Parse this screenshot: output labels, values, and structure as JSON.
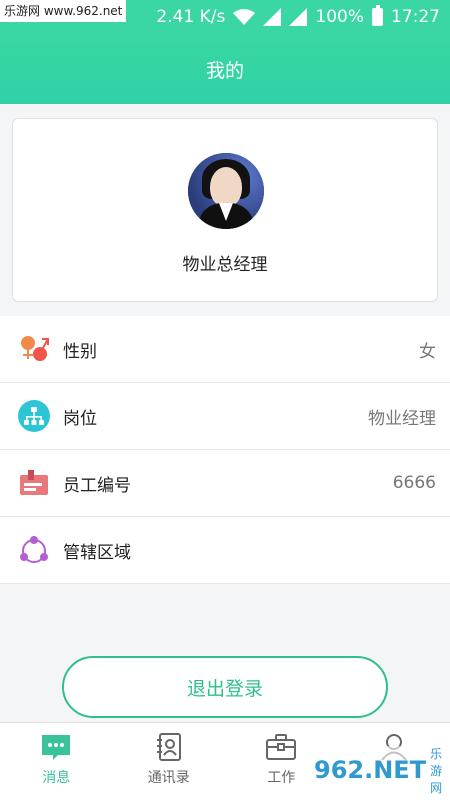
{
  "status": {
    "watermark": "乐游网 www.962.net",
    "speed": "2.41 K/s",
    "battery": "100%",
    "time": "17:27"
  },
  "header": {
    "title": "我的"
  },
  "profile": {
    "name": "物业总经理"
  },
  "info_list": [
    {
      "label": "性别",
      "value": "女",
      "icon": "gender-icon"
    },
    {
      "label": "岗位",
      "value": "物业经理",
      "icon": "org-chart-icon"
    },
    {
      "label": "员工编号",
      "value": "6666",
      "icon": "id-card-icon"
    },
    {
      "label": "管辖区域",
      "value": "",
      "icon": "region-icon"
    }
  ],
  "actions": {
    "logout_label": "退出登录"
  },
  "tabs": [
    {
      "label": "消息",
      "icon": "message-icon",
      "active": true
    },
    {
      "label": "通讯录",
      "icon": "contacts-icon",
      "active": false
    },
    {
      "label": "工作",
      "icon": "briefcase-icon",
      "active": false
    },
    {
      "label": "",
      "icon": "user-icon",
      "active": false
    }
  ],
  "watermark_bottom": {
    "text": "962.NET",
    "subtext": "乐游网"
  },
  "colors": {
    "brand": "#3ad6a3",
    "accent": "#2fbf8f"
  }
}
